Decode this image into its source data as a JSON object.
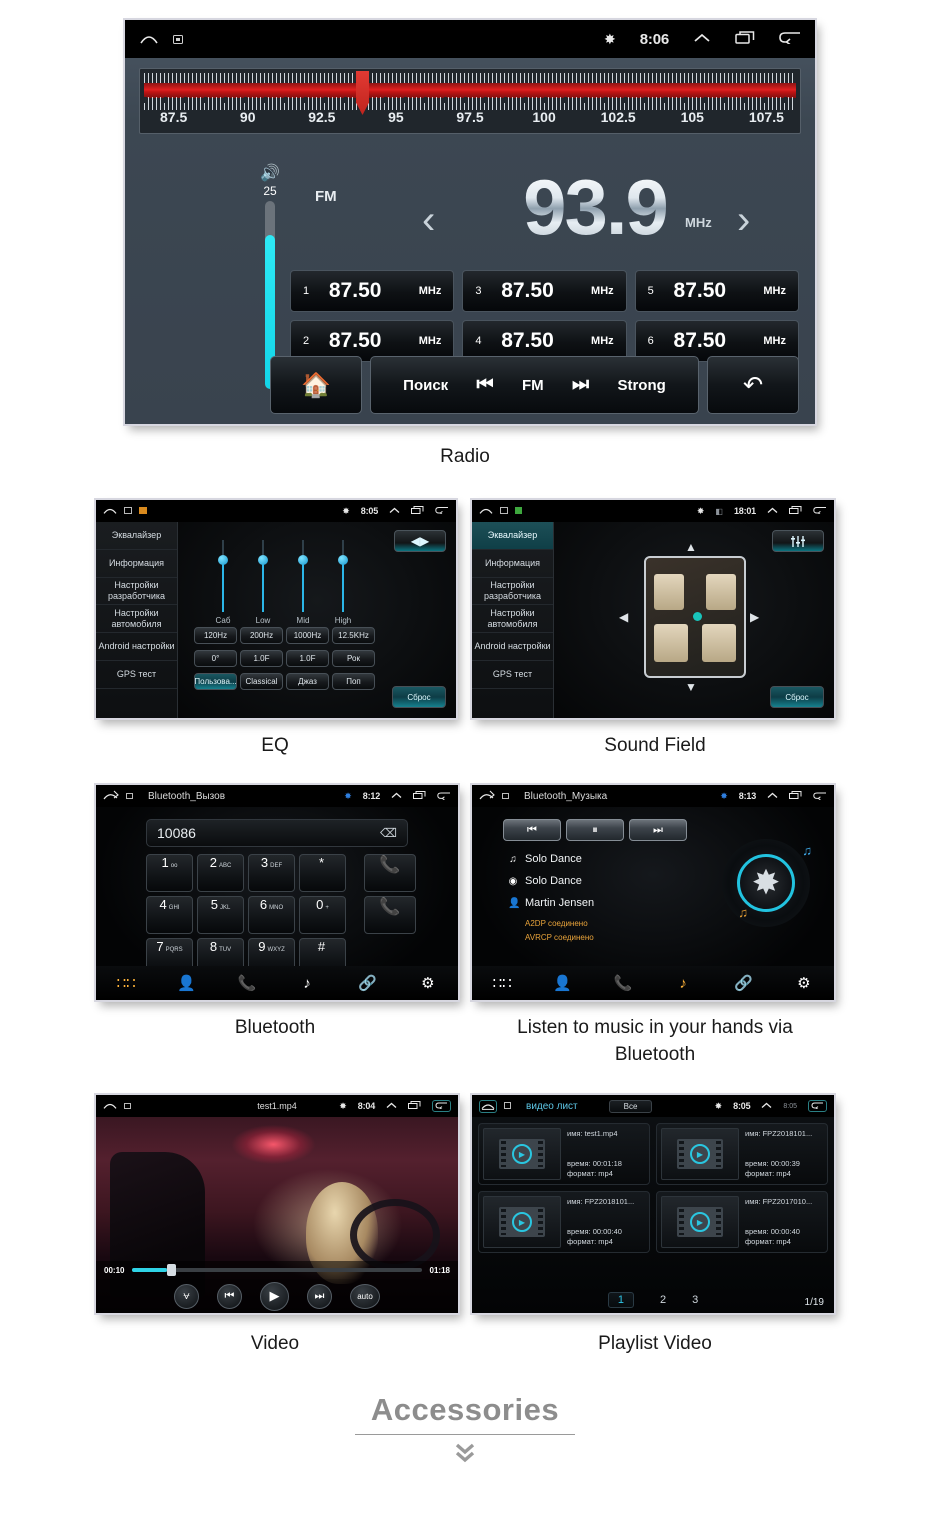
{
  "page": {
    "footer_title": "Accessories"
  },
  "radio": {
    "caption": "Radio",
    "statusbar": {
      "time": "8:06",
      "bluetooth_icon": "bluetooth-icon"
    },
    "tuner": {
      "ticks": [
        "87.5",
        "90",
        "92.5",
        "95",
        "97.5",
        "100",
        "102.5",
        "105",
        "107.5"
      ],
      "needle_value": "93.9",
      "range_min": 86.5,
      "range_max": 108.5
    },
    "volume": {
      "value": "25",
      "level_percent": 82
    },
    "band": "FM",
    "frequency": "93.9",
    "unit": "MHz",
    "presets": [
      {
        "num": "1",
        "freq": "87.50",
        "unit": "MHz"
      },
      {
        "num": "3",
        "freq": "87.50",
        "unit": "MHz"
      },
      {
        "num": "5",
        "freq": "87.50",
        "unit": "MHz"
      },
      {
        "num": "2",
        "freq": "87.50",
        "unit": "MHz"
      },
      {
        "num": "4",
        "freq": "87.50",
        "unit": "MHz"
      },
      {
        "num": "6",
        "freq": "87.50",
        "unit": "MHz"
      }
    ],
    "bottom": {
      "search": "Поиск",
      "band": "FM",
      "strong": "Strong"
    }
  },
  "eq": {
    "caption": "EQ",
    "statusbar": {
      "time": "8:05"
    },
    "sidebar": [
      "Эквалайзер",
      "Информация",
      "Настройки разработчика",
      "Настройки автомобиля",
      "Android настройки",
      "GPS тест"
    ],
    "sliders": [
      {
        "label": "Саб",
        "value": 72
      },
      {
        "label": "Low",
        "value": 72
      },
      {
        "label": "Mid",
        "value": 72
      },
      {
        "label": "High",
        "value": 72
      }
    ],
    "row_freq": [
      "120Hz",
      "200Hz",
      "1000Hz",
      "12.5KHz"
    ],
    "row_gain": [
      "0°",
      "1.0F",
      "1.0F",
      "Рок"
    ],
    "row_preset": [
      "Пользова...",
      "Classical",
      "Джаз",
      "Поп"
    ],
    "active_preset": "Пользова...",
    "reset_label": "Сброс",
    "toggle_icon": "balance-icon"
  },
  "sound_field": {
    "caption": "Sound Field",
    "statusbar": {
      "time": "18:01"
    },
    "sidebar": [
      "Эквалайзер",
      "Информация",
      "Настройки разработчика",
      "Настройки автомобиля",
      "Android настройки",
      "GPS тест"
    ],
    "active_sidebar": "Эквалайзер",
    "reset_label": "Сброс",
    "eq_icon": "equalizer-icon",
    "arrows": [
      "up",
      "left",
      "right",
      "down"
    ]
  },
  "bluetooth": {
    "caption": "Bluetooth",
    "title": "Bluetooth_Вызов",
    "statusbar": {
      "time": "8:12"
    },
    "number": "10086",
    "keys": [
      {
        "digit": "1",
        "letters": "oo"
      },
      {
        "digit": "2",
        "letters": "ABC"
      },
      {
        "digit": "3",
        "letters": "DEF"
      },
      {
        "digit": "*",
        "letters": ""
      },
      {
        "digit": "4",
        "letters": "GHI"
      },
      {
        "digit": "5",
        "letters": "JKL"
      },
      {
        "digit": "6",
        "letters": "MNO"
      },
      {
        "digit": "0",
        "letters": "+"
      },
      {
        "digit": "7",
        "letters": "PQRS"
      },
      {
        "digit": "8",
        "letters": "TUV"
      },
      {
        "digit": "9",
        "letters": "WXYZ"
      },
      {
        "digit": "#",
        "letters": ""
      }
    ],
    "nav": [
      "dialpad-icon",
      "contacts-icon",
      "call-history-icon",
      "music-icon",
      "link-icon",
      "settings-icon"
    ],
    "active_nav": "dialpad-icon"
  },
  "bt_music": {
    "caption": "Listen to music in your hands via Bluetooth",
    "title": "Bluetooth_Музыка",
    "statusbar": {
      "time": "8:13"
    },
    "transport": [
      "prev-icon",
      "pause-icon",
      "next-icon"
    ],
    "track": "Solo Dance",
    "album": "Solo Dance",
    "artist": "Martin Jensen",
    "status_a2dp": "A2DP соединено",
    "status_avrcp": "AVRCP соединено",
    "nav": [
      "dialpad-icon",
      "contacts-icon",
      "call-history-icon",
      "music-icon",
      "link-icon",
      "settings-icon"
    ],
    "active_nav": "music-icon"
  },
  "video": {
    "caption": "Video",
    "title": "test1.mp4",
    "statusbar": {
      "time": "8:04"
    },
    "elapsed": "00:10",
    "duration": "01:18",
    "progress_percent": 12,
    "controls": [
      "eq-icon",
      "prev-icon",
      "play-icon",
      "next-icon",
      "auto"
    ],
    "auto_label": "auto"
  },
  "playlist": {
    "caption": "Playlist Video",
    "title": "видео лист",
    "filter_label": "Все",
    "statusbar": {
      "time": "8:05",
      "secondary_time": "8:05"
    },
    "labels": {
      "name": "имя:",
      "time": "время:",
      "format": "формат:"
    },
    "items": [
      {
        "name": "test1.mp4",
        "time": "00:01:18",
        "format": "mp4"
      },
      {
        "name": "FPZ2018101...",
        "time": "00:00:39",
        "format": "mp4"
      },
      {
        "name": "FPZ2018101...",
        "time": "00:00:40",
        "format": "mp4"
      },
      {
        "name": "FPZ2017010...",
        "time": "00:00:40",
        "format": "mp4"
      }
    ],
    "pages": [
      "1",
      "2",
      "3"
    ],
    "active_page": "1",
    "page_total": "1/19"
  }
}
